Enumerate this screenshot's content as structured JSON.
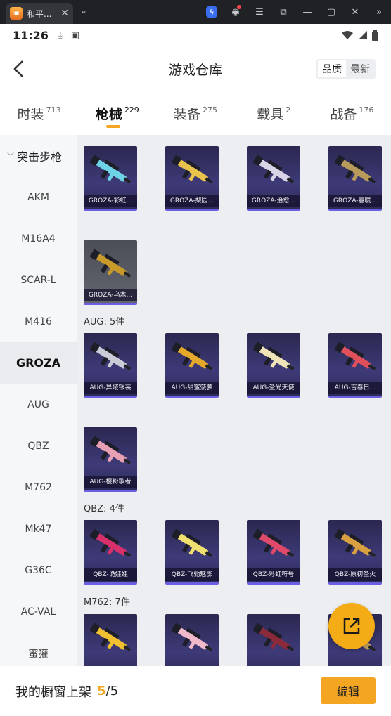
{
  "browser": {
    "tab_title": "和平...",
    "tab_close": "✕",
    "menu_chevron": "⌄"
  },
  "status_bar": {
    "time": "11:26"
  },
  "header": {
    "title": "游戏仓库",
    "sort_options": [
      "品质",
      "最新"
    ],
    "sort_selected": "品质"
  },
  "categories": [
    {
      "label": "时装",
      "count": "713",
      "active": false
    },
    {
      "label": "枪械",
      "count": "229",
      "active": true
    },
    {
      "label": "装备",
      "count": "275",
      "active": false
    },
    {
      "label": "载具",
      "count": "2",
      "active": false
    },
    {
      "label": "战备",
      "count": "176",
      "active": false
    }
  ],
  "sidebar": {
    "group": "突击步枪",
    "items": [
      "AKM",
      "M16A4",
      "SCAR-L",
      "M416",
      "GROZA",
      "AUG",
      "QBZ",
      "M762",
      "Mk47",
      "G36C",
      "AC-VAL",
      "蜜獾"
    ],
    "selected": "GROZA"
  },
  "sections": [
    {
      "title": "",
      "items": [
        {
          "name": "GROZA-彩虹...",
          "color": "#6fd3e8"
        },
        {
          "name": "GROZA-梨园...",
          "color": "#e8c24a"
        },
        {
          "name": "GROZA-治愈...",
          "color": "#d8d6e6"
        },
        {
          "name": "GROZA-春暖...",
          "color": "#b89a5a"
        },
        {
          "name": "GROZA-乌木...",
          "color": "#c89a2a"
        }
      ]
    },
    {
      "title": "AUG: 5件",
      "items": [
        {
          "name": "AUG-异域银装",
          "color": "#c9ccd6"
        },
        {
          "name": "AUG-甜蜜菠萝",
          "color": "#e4a92a"
        },
        {
          "name": "AUG-圣光天使",
          "color": "#efe3b8"
        },
        {
          "name": "AUG-吉春日...",
          "color": "#e0505a"
        },
        {
          "name": "AUG-樱粉歌者",
          "color": "#e8a0b4"
        }
      ]
    },
    {
      "title": "QBZ: 4件",
      "items": [
        {
          "name": "QBZ-诡娃娃",
          "color": "#d8306a"
        },
        {
          "name": "QBZ-飞驰魅影",
          "color": "#f0e070"
        },
        {
          "name": "QBZ-彩虹符号",
          "color": "#e04a6a"
        },
        {
          "name": "QBZ-原初圣火",
          "color": "#d8a040"
        }
      ]
    },
    {
      "title": "M762: 7件",
      "items": [
        {
          "name": "",
          "color": "#f0c030"
        },
        {
          "name": "",
          "color": "#f0b8c8"
        },
        {
          "name": "",
          "color": "#8a2a3a"
        },
        {
          "name": "",
          "color": "#c0a060"
        }
      ]
    }
  ],
  "bottom_bar": {
    "label": "我的橱窗上架",
    "shown": "5",
    "separator": "/",
    "total": "5",
    "edit_label": "编辑"
  },
  "colors": {
    "accent": "#f4a623",
    "card_bg": "#3e3a78"
  }
}
